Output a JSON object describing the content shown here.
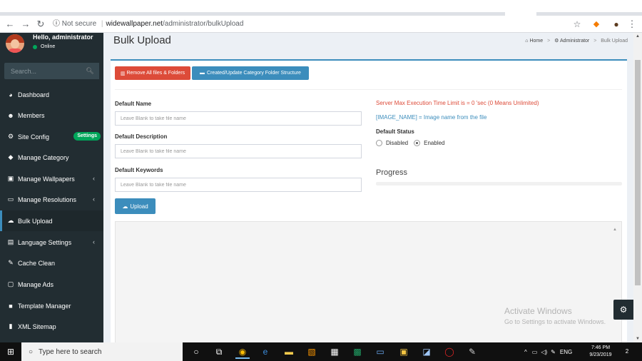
{
  "browser": {
    "not_secure": "Not secure",
    "host": "widewallpaper.net",
    "path": "/administrator/bulkUpload"
  },
  "sidebar": {
    "user_name": "Hello, administrator",
    "user_status": "Online",
    "search_placeholder": "Search...",
    "items": [
      {
        "label": "Dashboard",
        "icon": "dashboard-icon"
      },
      {
        "label": "Members",
        "icon": "users-icon"
      },
      {
        "label": "Site Config",
        "icon": "cogs-icon",
        "badge": "Settings"
      },
      {
        "label": "Manage Category",
        "icon": "tag-icon"
      },
      {
        "label": "Manage Wallpapers",
        "icon": "camera-icon"
      },
      {
        "label": "Manage Resolutions",
        "icon": "monitor-icon"
      },
      {
        "label": "Bulk Upload",
        "icon": "cloud-upload-icon"
      },
      {
        "label": "Language Settings",
        "icon": "language-icon"
      },
      {
        "label": "Cache Clean",
        "icon": "wrench-icon"
      },
      {
        "label": "Manage Ads",
        "icon": "ad-icon"
      },
      {
        "label": "Template Manager",
        "icon": "folder-icon"
      },
      {
        "label": "XML Sitemap",
        "icon": "file-icon"
      }
    ]
  },
  "header": {
    "title": "Bulk Upload",
    "breadcrumb": [
      "Home",
      "Administrator",
      "Bulk Upload"
    ]
  },
  "form": {
    "remove_button": "Remove All files & Folders",
    "create_button": "Created/Update Category Folder Structure",
    "default_name_label": "Default Name",
    "default_name_placeholder": "Leave Blank to take file name",
    "default_description_label": "Default Description",
    "default_description_placeholder": "Leave Blank to take file name",
    "default_keywords_label": "Default Keywords",
    "default_keywords_placeholder": "Leave Blank to take file name",
    "upload_button": "Upload",
    "server_limit": "Server Max Execution Time Limit is = 0 'sec (0 Means Unlimited)",
    "image_name_hint": "[IMAGE_NAME] = Image name from the file",
    "default_status_label": "Default Status",
    "status_options": [
      "Disabled",
      "Enabled"
    ],
    "status_selected": "Enabled",
    "progress_title": "Progress"
  },
  "watermark": {
    "line1": "Activate Windows",
    "line2": "Go to Settings to activate Windows."
  },
  "taskbar": {
    "search_placeholder": "Type here to search",
    "language": "ENG",
    "time": "7:46 PM",
    "date": "9/23/2019",
    "notifications": "2"
  },
  "colors": {
    "sidebar_bg": "#222d32",
    "accent_blue": "#3c8dbc",
    "danger_red": "#dd4b39",
    "success_green": "#00a65a"
  }
}
